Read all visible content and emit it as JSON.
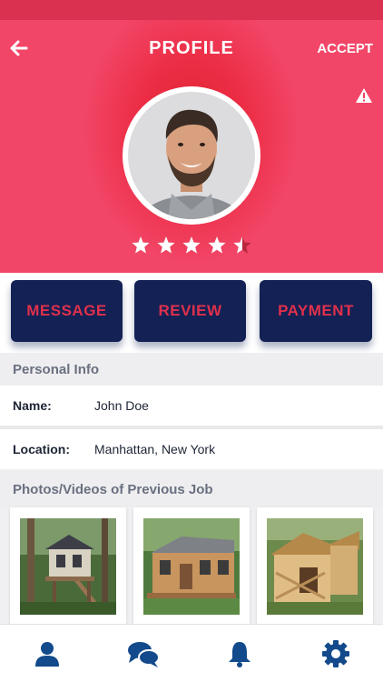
{
  "header": {
    "title": "PROFILE",
    "accept_label": "ACCEPT",
    "back_icon": "back-arrow-icon",
    "warning_icon": "warning-icon"
  },
  "profile": {
    "rating": 4.5,
    "rating_max": 5
  },
  "actions": {
    "message_label": "MESSAGE",
    "review_label": "REVIEW",
    "payment_label": "PAYMENT"
  },
  "personal_info": {
    "header": "Personal Info",
    "name_label": "Name:",
    "name_value": "John Doe",
    "location_label": "Location:",
    "location_value": "Manhattan, New York"
  },
  "gallery": {
    "header": "Photos/Videos of Previous Job",
    "photos": [
      "treehouse-photo",
      "tiny-house-photo",
      "dog-house-photo"
    ]
  },
  "tabbar": {
    "items": [
      "profile-icon",
      "chat-icon",
      "bell-icon",
      "gear-icon"
    ]
  },
  "colors": {
    "header_pink": "#f24668",
    "header_red": "#e0242f",
    "button_navy": "#132154",
    "button_text_red": "#e0304c",
    "tab_blue": "#124a8c"
  }
}
